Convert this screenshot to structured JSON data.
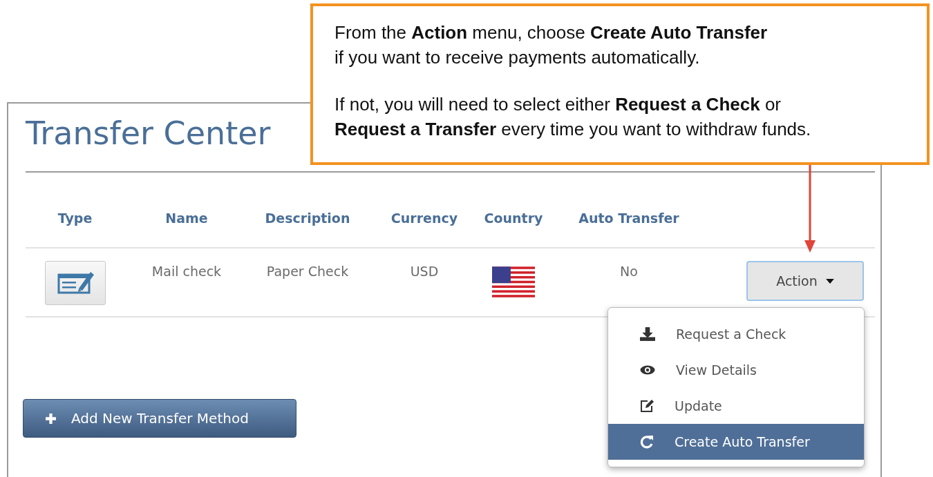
{
  "callout": {
    "paragraphs": [
      "From the **Action** menu, choose **Create Auto Transfer**\nif you want to receive payments automatically.",
      "If not, you will need to select either **Request a Check** or\n**Request a Transfer** every time you want to withdraw funds."
    ]
  },
  "page": {
    "title": "Transfer Center"
  },
  "table": {
    "columns": [
      "Type",
      "Name",
      "Description",
      "Currency",
      "Country",
      "Auto Transfer"
    ],
    "rows": [
      {
        "name": "Mail check",
        "description": "Paper Check",
        "currency": "USD",
        "auto_transfer": "No",
        "action": "Action"
      }
    ]
  },
  "action_menu": {
    "items": [
      {
        "kind": "download",
        "label": "Request a Check",
        "selected": false
      },
      {
        "kind": "view",
        "label": "View Details",
        "selected": false
      },
      {
        "kind": "edit",
        "label": "Update",
        "selected": false
      },
      {
        "kind": "refresh",
        "label": "Create Auto Transfer",
        "selected": true
      }
    ]
  },
  "add_button": {
    "label": "Add New Transfer Method"
  }
}
